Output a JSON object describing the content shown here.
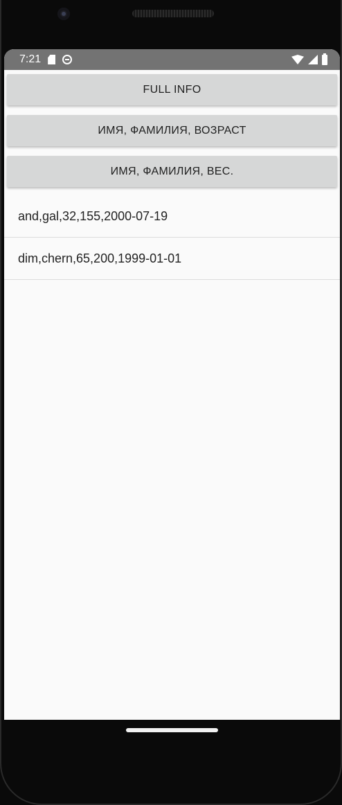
{
  "status_bar": {
    "time": "7:21",
    "icons": [
      "sd-card-icon",
      "face-icon",
      "wifi-icon",
      "signal-icon",
      "battery-icon"
    ]
  },
  "buttons": {
    "full_info": "FULL INFO",
    "name_surname_age": "ИМЯ, ФАМИЛИЯ, ВОЗРАСТ",
    "name_surname_weight": "ИМЯ, ФАМИЛИЯ, ВЕС."
  },
  "list": {
    "items": [
      "and,gal,32,155,2000-07-19",
      "dim,chern,65,200,1999-01-01"
    ]
  },
  "colors": {
    "status_bar": "#737373",
    "button_bg": "#d6d7d7",
    "screen_bg": "#fafafa"
  }
}
